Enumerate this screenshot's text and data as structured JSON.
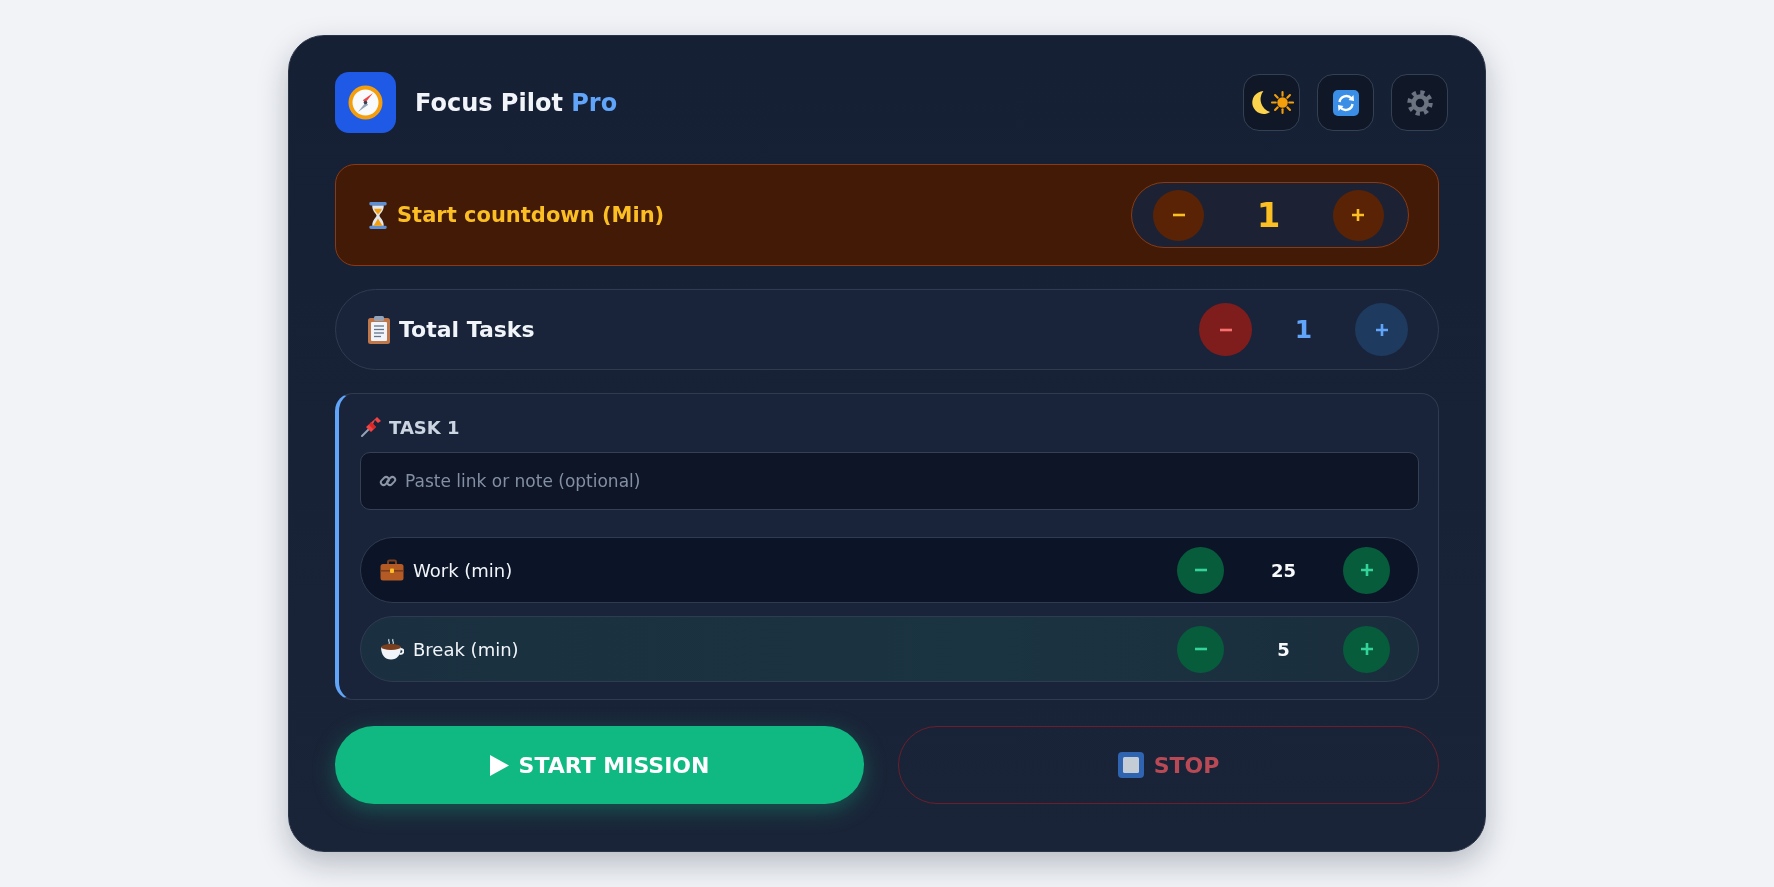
{
  "header": {
    "title": "Focus Pilot",
    "title_accent": "Pro"
  },
  "countdown": {
    "label": "Start countdown (Min)",
    "value": "1"
  },
  "total_tasks": {
    "label": "Total Tasks",
    "value": "1"
  },
  "tasks": [
    {
      "title": "TASK 1",
      "note": {
        "placeholder": "Paste link or note (optional)"
      },
      "settings": [
        {
          "kind": "work",
          "label": "Work (min)",
          "value": "25"
        },
        {
          "kind": "break",
          "label": "Break (min)",
          "value": "5"
        }
      ]
    }
  ],
  "buttons": [
    {
      "kind": "start",
      "label": "START MISSION"
    },
    {
      "kind": "stop",
      "label": "STOP"
    }
  ]
}
